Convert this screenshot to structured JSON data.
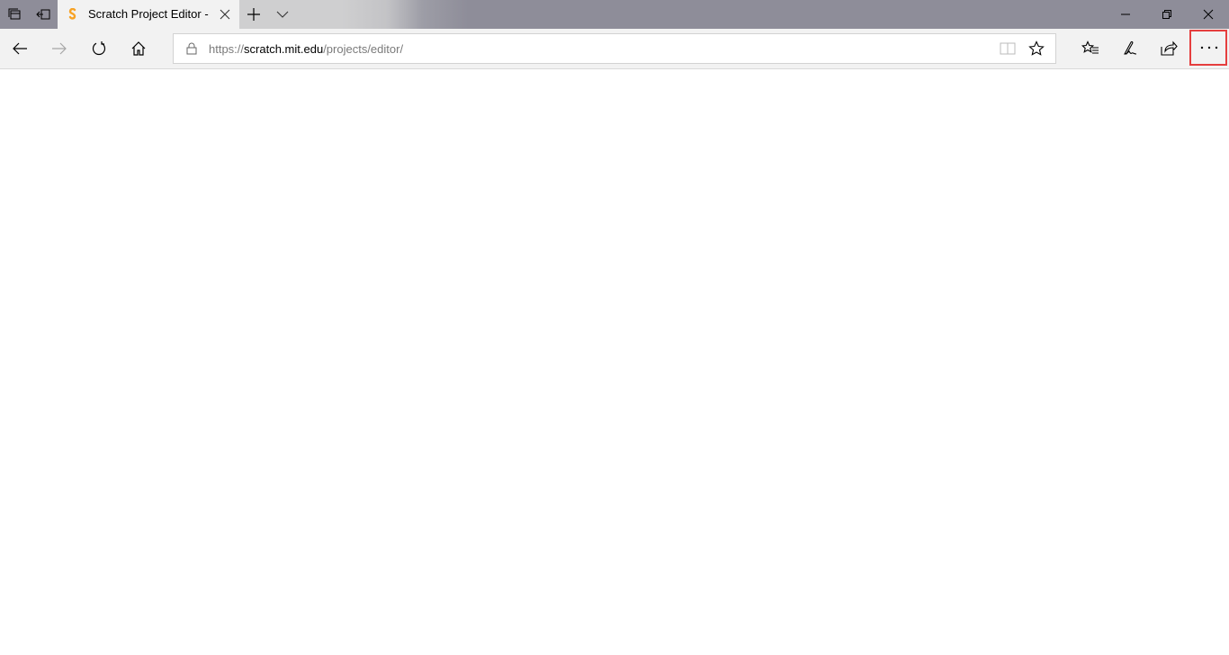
{
  "window": {
    "tab_title": "Scratch Project Editor -",
    "favicon": "scratch-logo-icon",
    "accent_color": "#f7a326",
    "controls": {
      "minimize": "minimize-icon",
      "restore": "restore-icon",
      "close": "close-icon"
    },
    "tab_actions": [
      "tabs-aside-icon",
      "set-aside-tabs-icon"
    ],
    "new_tab": "plus-icon",
    "tab_list": "chevron-down-icon"
  },
  "navbar": {
    "buttons": [
      "back-icon",
      "forward-icon",
      "refresh-icon",
      "home-icon"
    ],
    "address": {
      "scheme": "https://",
      "host": "scratch.mit.edu",
      "path": "/projects/editor/"
    },
    "address_icons": [
      "lock-icon",
      "reading-view-icon",
      "favorite-star-icon"
    ],
    "toolbar": [
      "favorites-hub-icon",
      "web-note-icon",
      "share-icon",
      "more-icon"
    ],
    "highlight_color": "#e53e3e"
  }
}
